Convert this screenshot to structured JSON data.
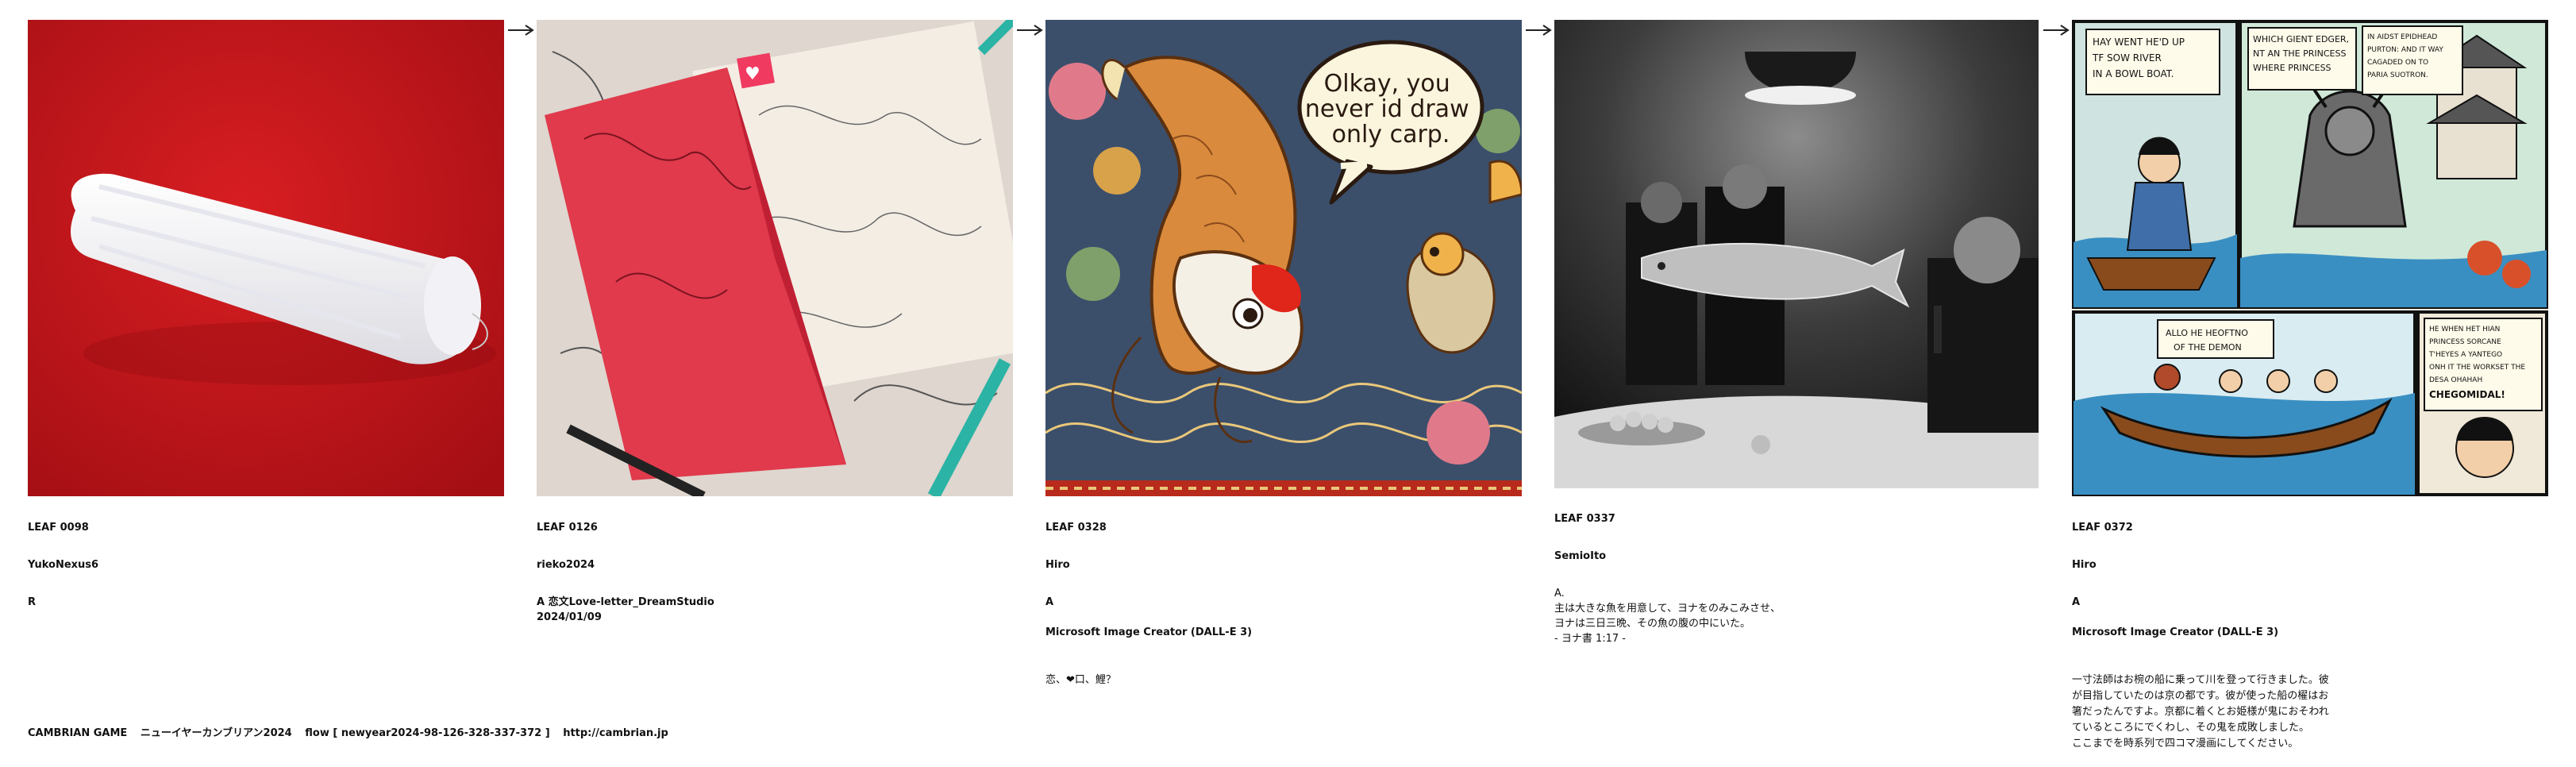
{
  "cards": [
    {
      "leaf": "LEAF 0098",
      "author": "YukoNexus6",
      "desc": "R",
      "tool": "",
      "note": "",
      "image": "white rolled towel on red background"
    },
    {
      "leaf": "LEAF 0126",
      "author": "rieko2024",
      "desc": "A 恋文Love-letter_DreamStudio\n2024/01/09",
      "tool": "",
      "note": "",
      "image": "folded red paper on sketches"
    },
    {
      "leaf": "LEAF 0328",
      "author": "Hiro",
      "desc": "A",
      "tool": "Microsoft Image Creator (DALL-E 3)",
      "note": "恋、❤口、鯉？",
      "image": "koi illustration with speech bubble",
      "bubble": "Olkay, you\nnever id draw\nonly carp."
    },
    {
      "leaf": "LEAF 0337",
      "author": "SemioIto",
      "desc": "A.\n主は大きな魚を用意して、ヨナをのみこみさせ、\nヨナは三日三晩、その魚の腹の中にいた。\n- ヨナ書 1:17 -",
      "tool": "",
      "note": "",
      "image": "black and white photo with fish"
    },
    {
      "leaf": "LEAF 0372",
      "author": "Hiro",
      "desc": "A",
      "tool": "Microsoft Image Creator (DALL-E 3)",
      "note": "一寸法師はお椀の船に乗って川を登って行きました。彼\nが目指していたのは京の都です。彼が使った船の櫂はお\n箸だったんですよ。京都に着くとお姫様が鬼におそわれ\nているところにでくわし、その鬼を成敗しました。\nここまでを時系列で四コマ漫画にしてください。",
      "image": "four-panel manga",
      "panels": [
        "HAY WENT HE'D UP\nTF SOW RIVER\nIN A BOWL BOAT.",
        "WHICH GIENT EDGER,\nNT AN THE PRINCESS\nWHERE PRINCESS",
        "IN AIDST EPIDHEAD\nPURTON: AND IT WAY\nCAGADED ON TO\nPARIA SUOTRON.",
        "ALLO HE HEOFTNO\nOF THE DEMON",
        "HE WHEN HET HIAN\nPRINCESS SORCANE\nT'HEYES A YANTEGO\nONH IT THE WORKSET THE\nDESA OHAHAH\nCHEGOMIDAL!"
      ]
    }
  ],
  "footer": {
    "game": "CAMBRIAN GAME",
    "title": "ニューイヤーカンブリアン2024",
    "flow": "flow [ newyear2024-98-126-328-337-372 ]",
    "url": "http://cambrian.jp"
  },
  "colors": {
    "red": "#c8181c",
    "koi_orange": "#d98a3c",
    "manga_sea": "#3a8fc2"
  }
}
